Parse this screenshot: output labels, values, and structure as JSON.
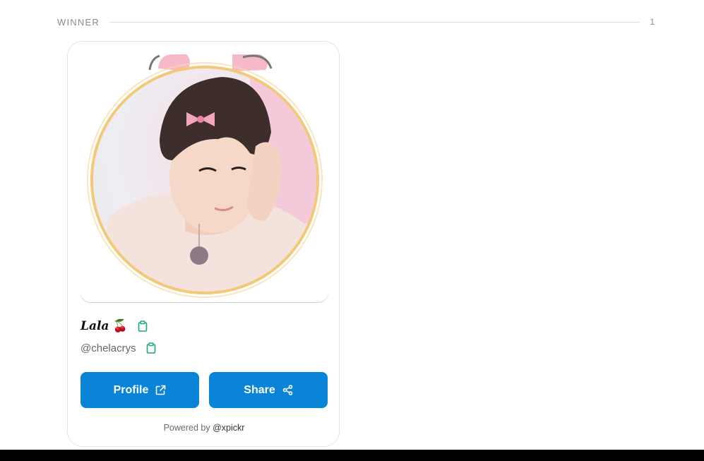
{
  "section": {
    "title": "WINNER",
    "count": "1"
  },
  "card": {
    "image": {
      "icon": "profile-photo",
      "alt": ""
    },
    "name": "Lala",
    "name_emoji": "🍒",
    "handle": "@chelacrys",
    "copy_icon": "clipboard-icon",
    "buttons": {
      "profile_label": "Profile",
      "share_label": "Share"
    },
    "powered_prefix": "Powered by",
    "powered_handle": "@xpickr"
  },
  "colors": {
    "accent": "#0a84d6",
    "copy_icon": "#1aa57a",
    "frame_ring": "#f3c878"
  }
}
